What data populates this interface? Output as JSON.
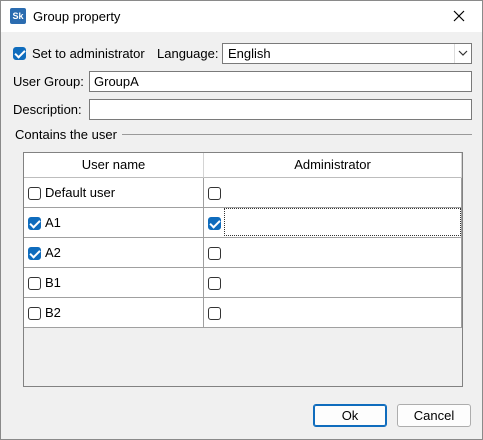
{
  "window": {
    "title": "Group property",
    "icon": "app-logo-icon"
  },
  "form": {
    "admin_checkbox": {
      "label": "Set to administrator",
      "checked": true
    },
    "language_label": "Language:",
    "language_value": "English",
    "user_group_label": "User Group:",
    "user_group_value": "GroupA",
    "description_label": "Description:",
    "description_value": "",
    "group_box_label": "Contains the user"
  },
  "table": {
    "columns": [
      "User name",
      "Administrator"
    ],
    "rows": [
      {
        "name": "Default user",
        "member": false,
        "admin": false
      },
      {
        "name": "A1",
        "member": true,
        "admin": true
      },
      {
        "name": "A2",
        "member": true,
        "admin": false
      },
      {
        "name": "B1",
        "member": false,
        "admin": false
      },
      {
        "name": "B2",
        "member": false,
        "admin": false
      }
    ]
  },
  "buttons": {
    "ok": "Ok",
    "cancel": "Cancel"
  },
  "colors": {
    "accent": "#0f6cbd"
  }
}
